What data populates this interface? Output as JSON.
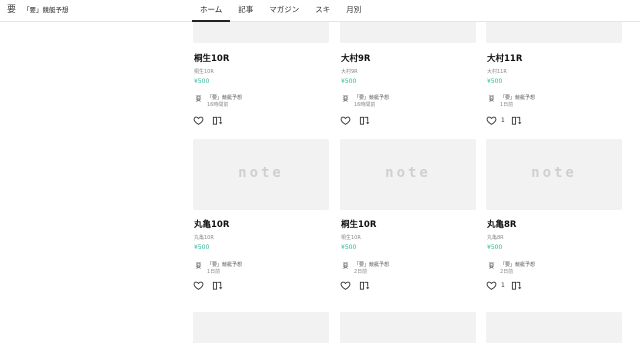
{
  "header": {
    "brand_icon": "要",
    "brand_name": "「要」競艇予想",
    "tabs": [
      "ホーム",
      "記事",
      "マガジン",
      "スキ",
      "月別"
    ]
  },
  "logo_text": "note",
  "cards": [
    {
      "title": "桐生10R",
      "sub": "桐生10R",
      "price": "¥500",
      "avatar": "要",
      "author": "「要」競艇予想",
      "time": "16時間前",
      "likes": ""
    },
    {
      "title": "大村9R",
      "sub": "大村9R",
      "price": "¥500",
      "avatar": "要",
      "author": "「要」競艇予想",
      "time": "16時間前",
      "likes": ""
    },
    {
      "title": "大村11R",
      "sub": "大村11R",
      "price": "¥500",
      "avatar": "要",
      "author": "「要」競艇予想",
      "time": "1日前",
      "likes": "1"
    },
    {
      "title": "丸亀10R",
      "sub": "丸亀10R",
      "price": "¥500",
      "avatar": "要",
      "author": "「要」競艇予想",
      "time": "1日前",
      "likes": ""
    },
    {
      "title": "桐生10R",
      "sub": "桐生10R",
      "price": "¥500",
      "avatar": "要",
      "author": "「要」競艇予想",
      "time": "2日前",
      "likes": ""
    },
    {
      "title": "丸亀8R",
      "sub": "丸亀8R",
      "price": "¥500",
      "avatar": "要",
      "author": "「要」競艇予想",
      "time": "2日前",
      "likes": "1"
    }
  ],
  "colors": {
    "price": "#2cb696",
    "thumb": "#f2f2f2"
  },
  "icons": {
    "like": "heart-icon",
    "magazine": "magazine-add-icon"
  }
}
